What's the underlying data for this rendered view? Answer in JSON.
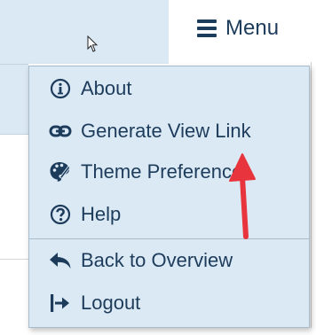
{
  "header": {
    "menu_label": "Menu"
  },
  "menu": {
    "items": [
      {
        "label": "About",
        "icon": "info-circle-icon"
      },
      {
        "label": "Generate View Link",
        "icon": "link-icon"
      },
      {
        "label": "Theme Preference",
        "icon": "palette-icon"
      },
      {
        "label": "Help",
        "icon": "question-circle-icon"
      },
      {
        "label": "Back to Overview",
        "icon": "reply-arrow-icon"
      },
      {
        "label": "Logout",
        "icon": "sign-out-icon"
      }
    ]
  },
  "colors": {
    "text": "#1d3c5c",
    "panel_bg": "#dbe9f4",
    "annotation_arrow": "#e8343c"
  }
}
